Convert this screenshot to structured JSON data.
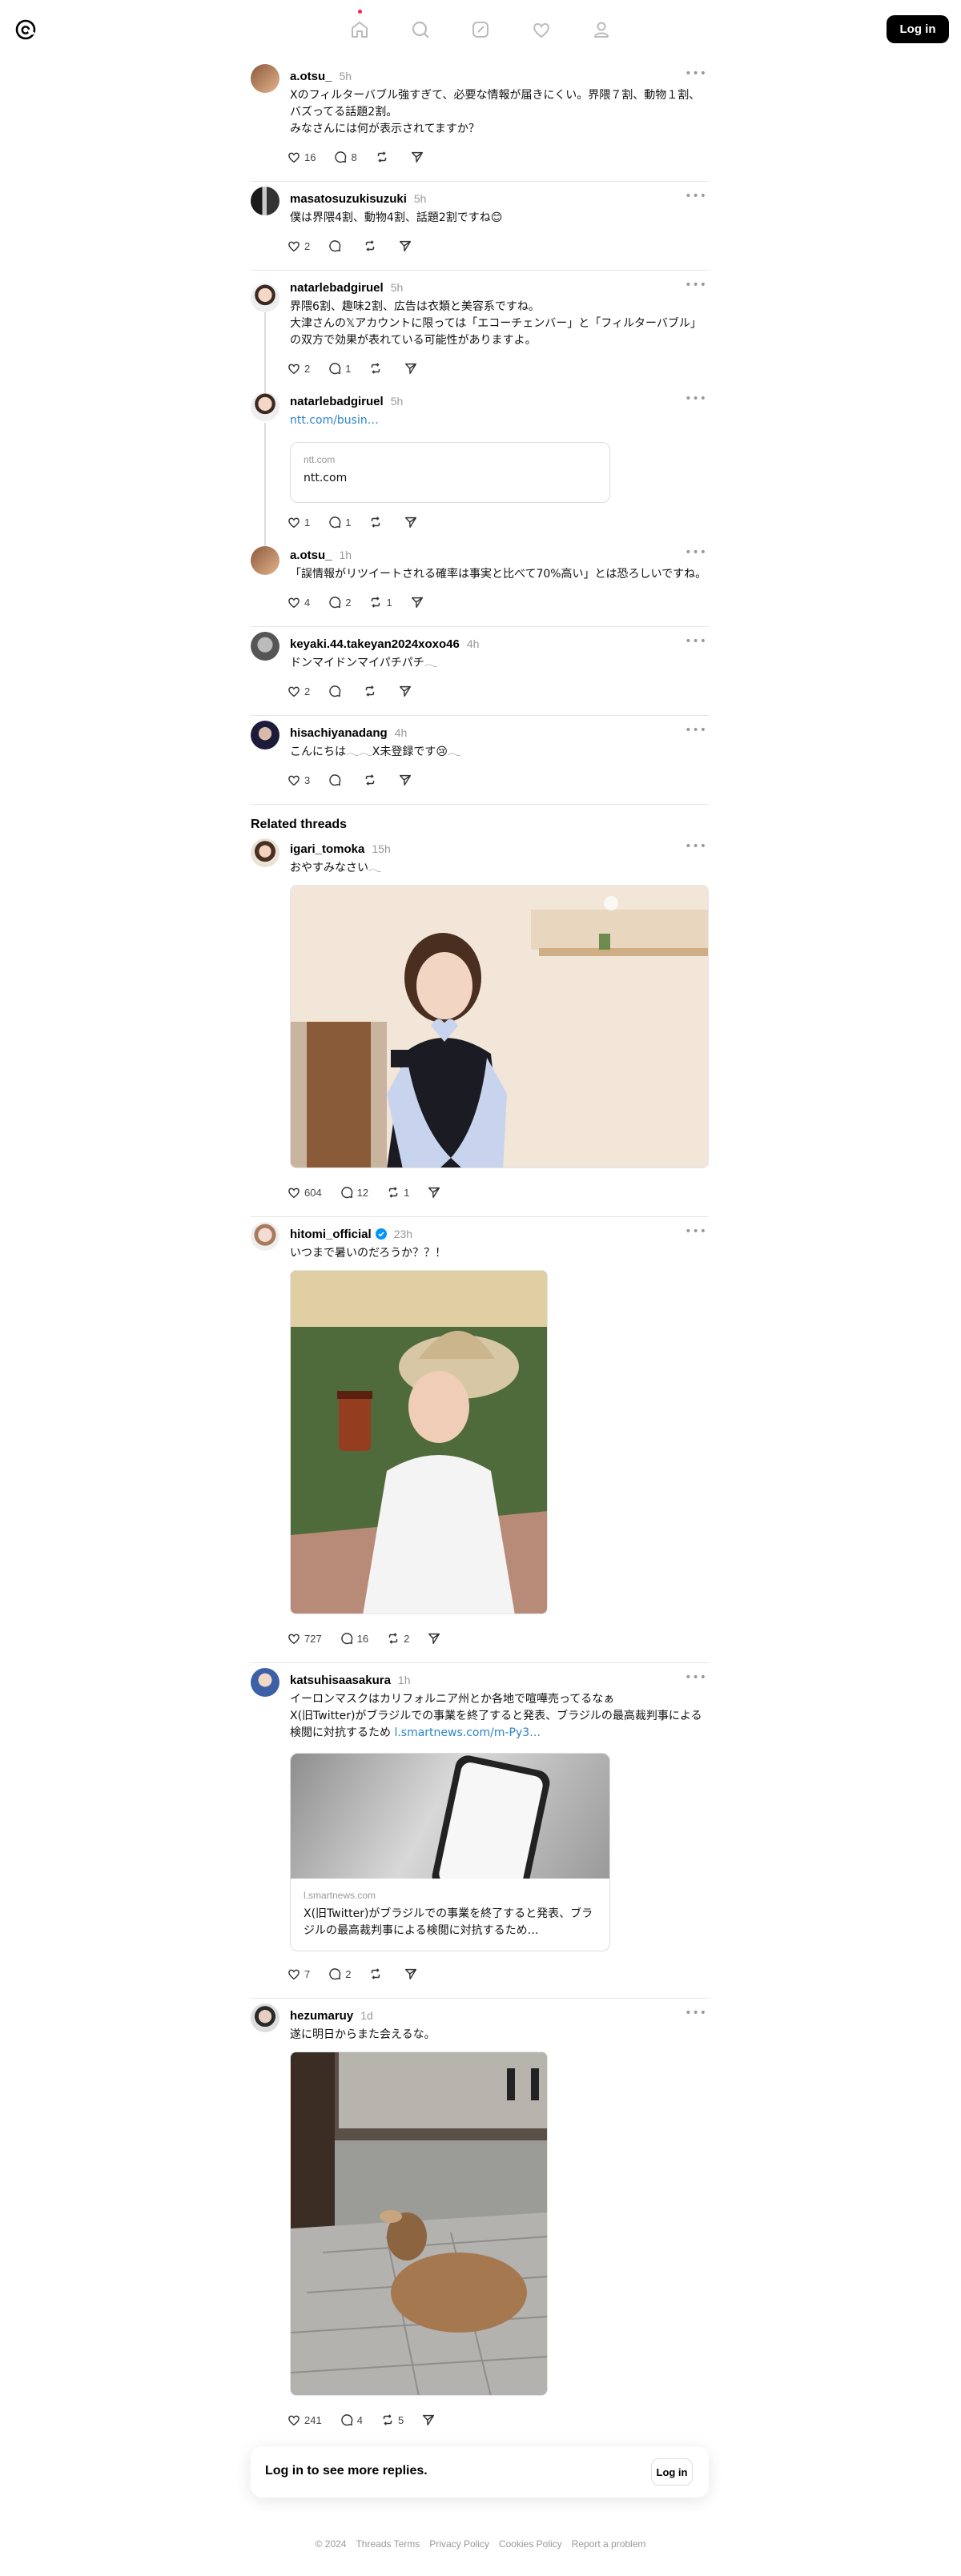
{
  "header": {
    "login_label": "Log in",
    "nav": [
      "home-icon",
      "search-icon",
      "compose-icon",
      "heart-icon",
      "profile-icon"
    ]
  },
  "main_post": {
    "user": "a.otsu_",
    "time": "5h",
    "text": "Xのフィルターバブル強すぎて、必要な情報が届きにくい。界隈７割、動物１割、バズってる話題2割。\nみなさんには何が表示されてますか？",
    "likes": "16",
    "replies": "8"
  },
  "replies": [
    {
      "user": "masatosuzukisuzuki",
      "time": "5h",
      "text": "僕は界隈4割、動物4割、話題2割ですね😊",
      "likes": "2",
      "replies": "",
      "reposts": ""
    },
    {
      "user": "natarlebadgiruel",
      "time": "5h",
      "text": "界隈6割、趣味2割、広告は衣類と美容系ですね。\n大津さんの𝕏アカウントに限っては「エコーチェンバー」と「フィルターバブル」の双方で効果が表れている可能性がありますよ。",
      "likes": "2",
      "replies": "1",
      "reposts": ""
    },
    {
      "user": "natarlebadgiruel",
      "time": "5h",
      "link": "ntt.com/busin…",
      "card_domain": "ntt.com",
      "card_title": "ntt.com",
      "likes": "1",
      "replies": "1",
      "reposts": ""
    },
    {
      "user": "a.otsu_",
      "time": "1h",
      "text": "「誤情報がリツイートされる確率は事実と比べて70%高い」とは恐ろしいですね。",
      "likes": "4",
      "replies": "2",
      "reposts": "1"
    },
    {
      "user": "keyaki.44.takeyan2024xoxo46",
      "time": "4h",
      "text": "ドンマイドンマイパチパチ𓂃",
      "likes": "2",
      "replies": "",
      "reposts": ""
    },
    {
      "user": "hisachiyanadang",
      "time": "4h",
      "text": "こんにちは𓂃𓂃X未登録です😢𓂃",
      "likes": "3",
      "replies": "",
      "reposts": ""
    }
  ],
  "related": {
    "title": "Related threads",
    "posts": [
      {
        "user": "igari_tomoka",
        "time": "15h",
        "text": "おやすみなさい𓂃",
        "likes": "604",
        "replies": "12",
        "reposts": "1"
      },
      {
        "user": "hitomi_official",
        "time": "23h",
        "text": "いつまで暑いのだろうか？？！",
        "likes": "727",
        "replies": "16",
        "reposts": "2"
      },
      {
        "user": "katsuhisaasakura",
        "time": "1h",
        "text": "イーロンマスクはカリフォルニア州とか各地で喧嘩売ってるなぁ\nX(旧Twitter)がブラジルでの事業を終了すると発表、ブラジルの最高裁判事による検閲に対抗するため ",
        "link": "l.smartnews.com/m-Py3…",
        "card_domain": "l.smartnews.com",
        "card_title": "X(旧Twitter)がブラジルでの事業を終了すると発表、ブラジルの最高裁判事による検閲に対抗するため…",
        "likes": "7",
        "replies": "2",
        "reposts": ""
      },
      {
        "user": "hezumaruy",
        "time": "1d",
        "text": "遂に明日からまた会えるな。",
        "likes": "241",
        "replies": "4",
        "reposts": "5"
      }
    ]
  },
  "login_bar": {
    "text": "Log in to see more replies.",
    "button": "Log in"
  },
  "footer": [
    "© 2024",
    "Threads Terms",
    "Privacy Policy",
    "Cookies Policy",
    "Report a problem"
  ],
  "colors": {
    "accent_dot": "#ff1f55",
    "link": "#2a84c8",
    "verified": "#0095f6"
  }
}
